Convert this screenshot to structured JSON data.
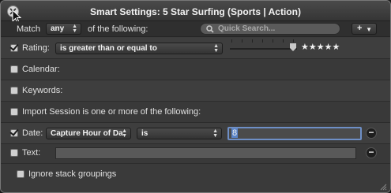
{
  "window": {
    "title": "Smart Settings: 5 Star Surfing (Sports | Action)"
  },
  "match": {
    "label_prefix": "Match",
    "mode": "any",
    "label_suffix": "of the following:",
    "search_placeholder": "Quick Search...",
    "add_label": "+"
  },
  "rules": {
    "rating": {
      "checked": true,
      "label": "Rating:",
      "operator": "is greater than or equal to",
      "stars": "★★★★★",
      "value_stars": 5
    },
    "calendar": {
      "checked": false,
      "label": "Calendar:"
    },
    "keywords": {
      "checked": false,
      "label": "Keywords:"
    },
    "import_session": {
      "checked": false,
      "label": "Import Session is one or more of the following:"
    },
    "date": {
      "checked": true,
      "label": "Date:",
      "field": "Capture Hour of Da",
      "operator": "is",
      "value": "8"
    },
    "text": {
      "checked": false,
      "label": "Text:",
      "value": ""
    }
  },
  "options": {
    "ignore_stack_label": "Ignore stack groupings",
    "ignore_stack_checked": false
  },
  "remove_label": "−"
}
